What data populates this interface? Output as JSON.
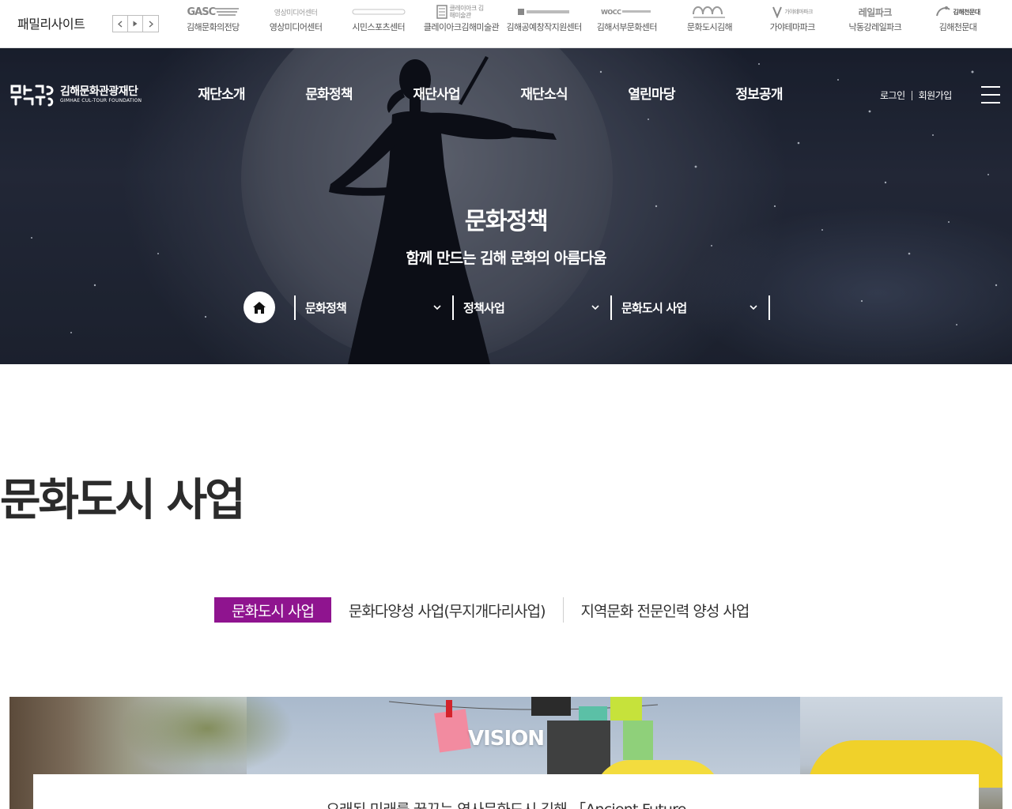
{
  "family": {
    "title": "패밀리사이트",
    "prev_label": "‹",
    "next_label": "›",
    "items": [
      {
        "logo_text": "GASC",
        "name": "김해문화의전당"
      },
      {
        "logo_text": "영상미디어센터",
        "name": "영상미디어센터"
      },
      {
        "logo_text": "",
        "name": "시민스포츠센터"
      },
      {
        "logo_text": "클레이아크 김해미술관",
        "name": "클레이아크김해미술관"
      },
      {
        "logo_text": "",
        "name": "김해공예창작지원센터"
      },
      {
        "logo_text": "WOCC",
        "name": "김해서부문화센터"
      },
      {
        "logo_text": "",
        "name": "문화도시김해"
      },
      {
        "logo_text": "가야테마파크",
        "name": "가야테마파크"
      },
      {
        "logo_text": "레일파크",
        "name": "낙동강레일파크"
      },
      {
        "logo_text": "김해천문대",
        "name": "김해천문대"
      }
    ]
  },
  "header": {
    "logo_kor": "김해문화관광재단",
    "logo_eng": "GIMHAE CUL-TOUR FOUNDATION",
    "menu": [
      "재단소개",
      "문화정책",
      "재단사업",
      "재단소식",
      "열린마당",
      "정보공개"
    ],
    "login": "로그인",
    "signup": "회원가입"
  },
  "hero": {
    "title": "문화정책",
    "subtitle": "함께 만드는 김해 문화의 아름다움",
    "lnb": [
      "문화정책",
      "정책사업",
      "문화도시 사업"
    ]
  },
  "content": {
    "page_title": "문화도시 사업",
    "tabs": [
      "문화도시 사업",
      "문화다양성 사업(무지개다리사업)",
      "지역문화 전문인력 양성 사업"
    ],
    "active_tab": 0,
    "vision_title": "VISION",
    "vision_text": "오래된 미래를 꿈꾸는 역사문화도시 김해 「Ancient Future"
  },
  "colors": {
    "accent": "#8f148f",
    "hero_bg": "#2b3142"
  }
}
